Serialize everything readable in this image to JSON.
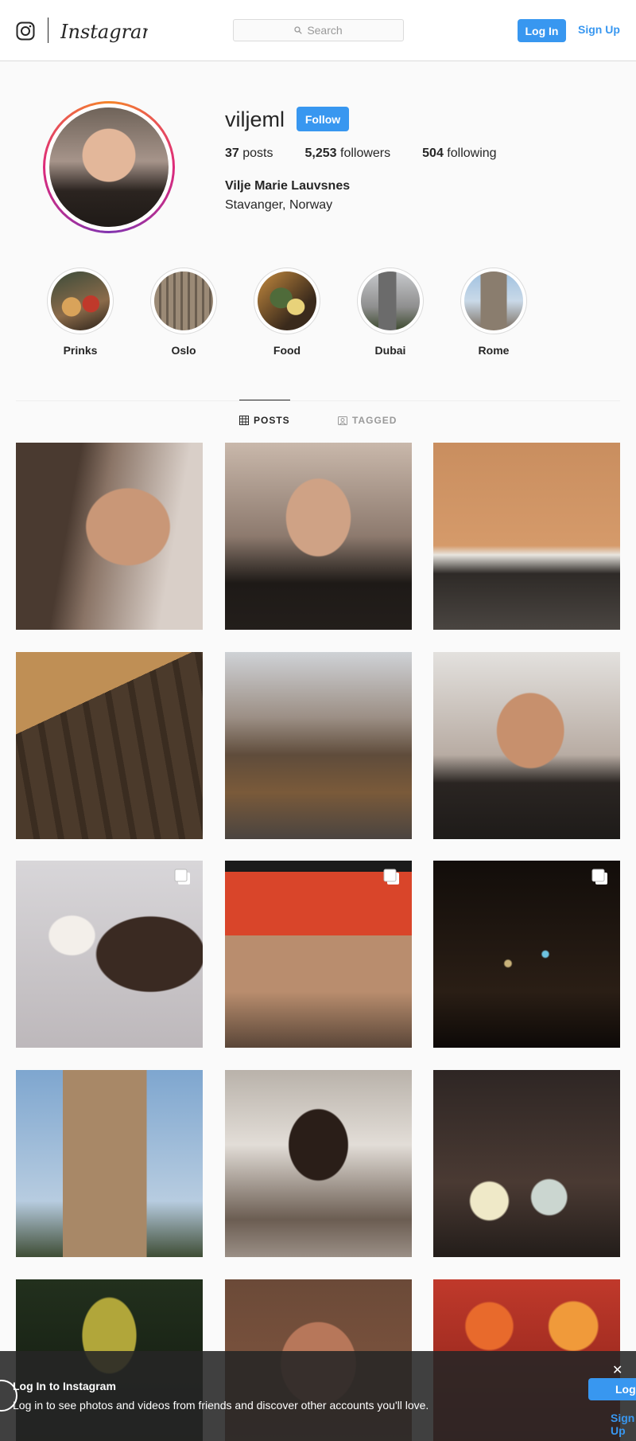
{
  "header": {
    "brand": "Instagram",
    "search_placeholder": "Search",
    "login_label": "Log In",
    "signup_label": "Sign Up"
  },
  "profile": {
    "username": "viljeml",
    "follow_label": "Follow",
    "posts_count": "37",
    "posts_label": "posts",
    "followers_count": "5,253",
    "followers_label": "followers",
    "following_count": "504",
    "following_label": "following",
    "full_name": "Vilje Marie Lauvsnes",
    "bio": "Stavanger, Norway"
  },
  "highlights": [
    {
      "label": "Prinks"
    },
    {
      "label": "Oslo"
    },
    {
      "label": "Food"
    },
    {
      "label": "Dubai"
    },
    {
      "label": "Rome"
    }
  ],
  "tabs": {
    "posts_label": "POSTS",
    "tagged_label": "TAGGED"
  },
  "banner": {
    "title": "Log In to Instagram",
    "text": "Log in to see photos and videos from friends and discover other accounts you'll love.",
    "login_label": "Log In",
    "signup_label": "Sign Up",
    "close_glyph": "✕"
  },
  "colors": {
    "accent": "#3897f0",
    "text": "#262626",
    "muted": "#999999",
    "border": "#dbdbdb",
    "background": "#fafafa"
  }
}
